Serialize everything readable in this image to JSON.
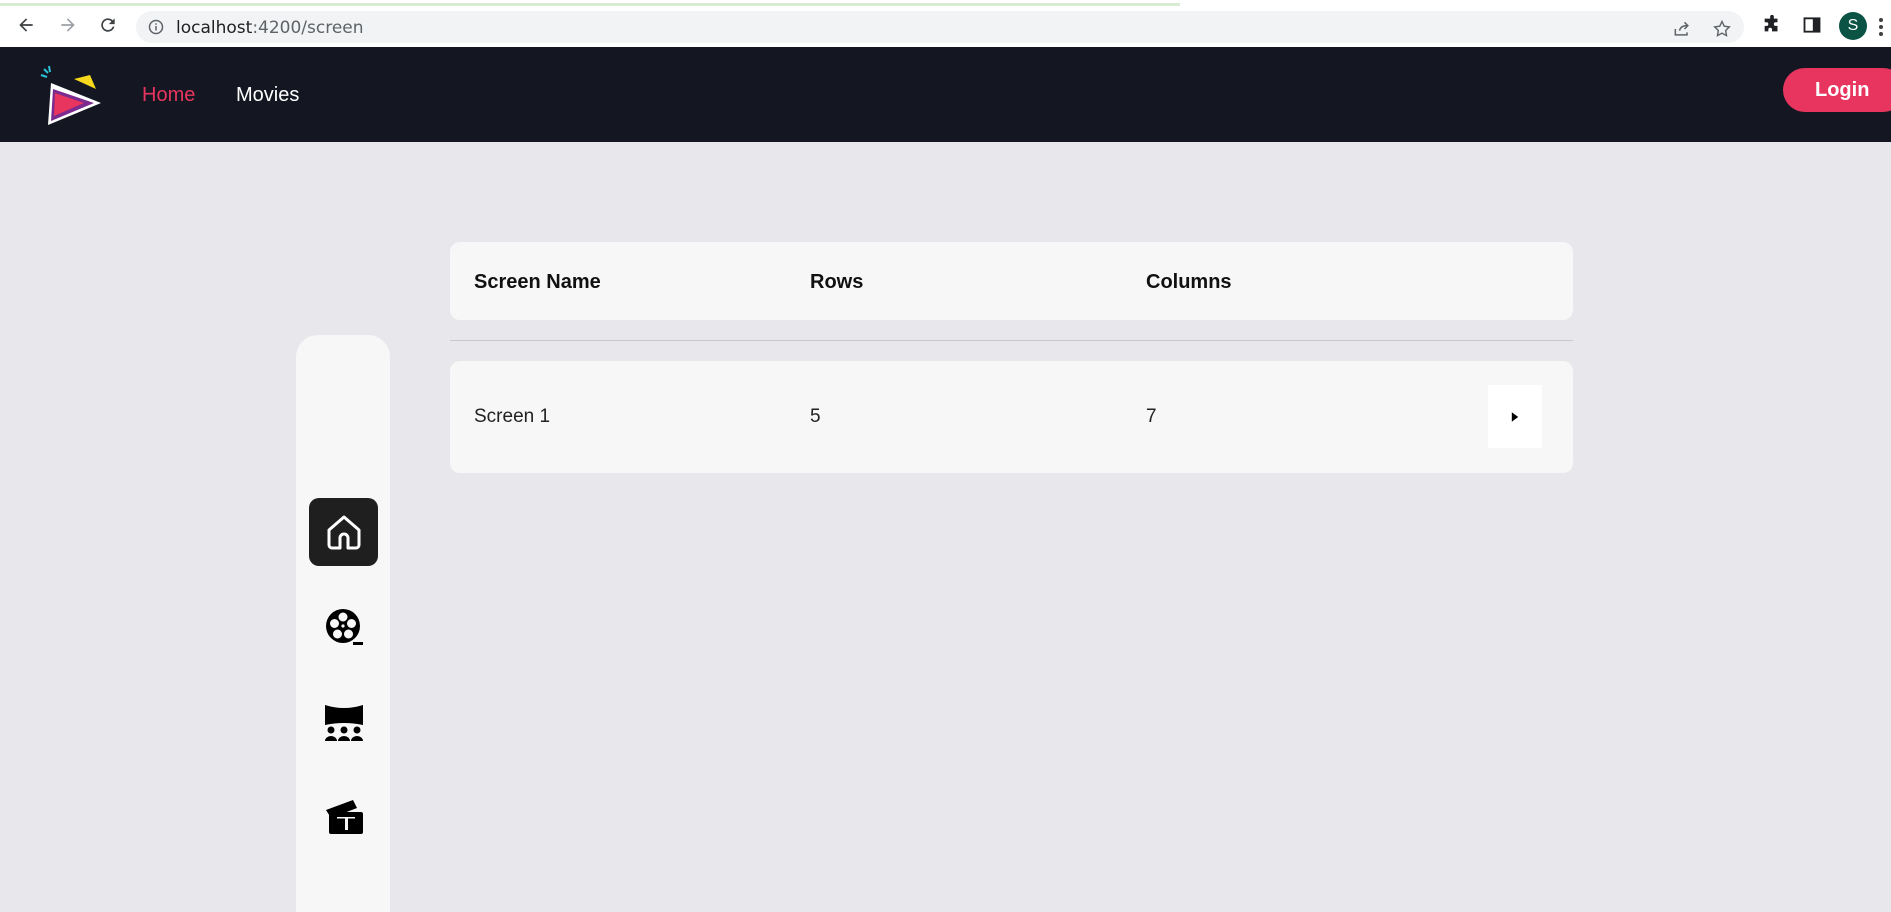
{
  "browser": {
    "url_host": "localhost",
    "url_path": ":4200/screen",
    "profile_initial": "S"
  },
  "header": {
    "nav": [
      {
        "label": "Home",
        "active": true
      },
      {
        "label": "Movies",
        "active": false
      }
    ],
    "login_label": "Login"
  },
  "sidebar": {
    "items": [
      {
        "icon": "home-icon",
        "active": true
      },
      {
        "icon": "film-reel-icon",
        "active": false
      },
      {
        "icon": "theater-screen-icon",
        "active": false
      },
      {
        "icon": "tickets-icon",
        "active": false
      }
    ]
  },
  "table": {
    "columns": [
      "Screen Name",
      "Rows",
      "Columns"
    ],
    "rows": [
      {
        "screen_name": "Screen 1",
        "rows": "5",
        "columns": "7"
      }
    ]
  },
  "colors": {
    "header_bg": "#141621",
    "accent": "#e8355f",
    "page_bg": "#e8e7ec",
    "card_bg": "#f7f7f7"
  }
}
